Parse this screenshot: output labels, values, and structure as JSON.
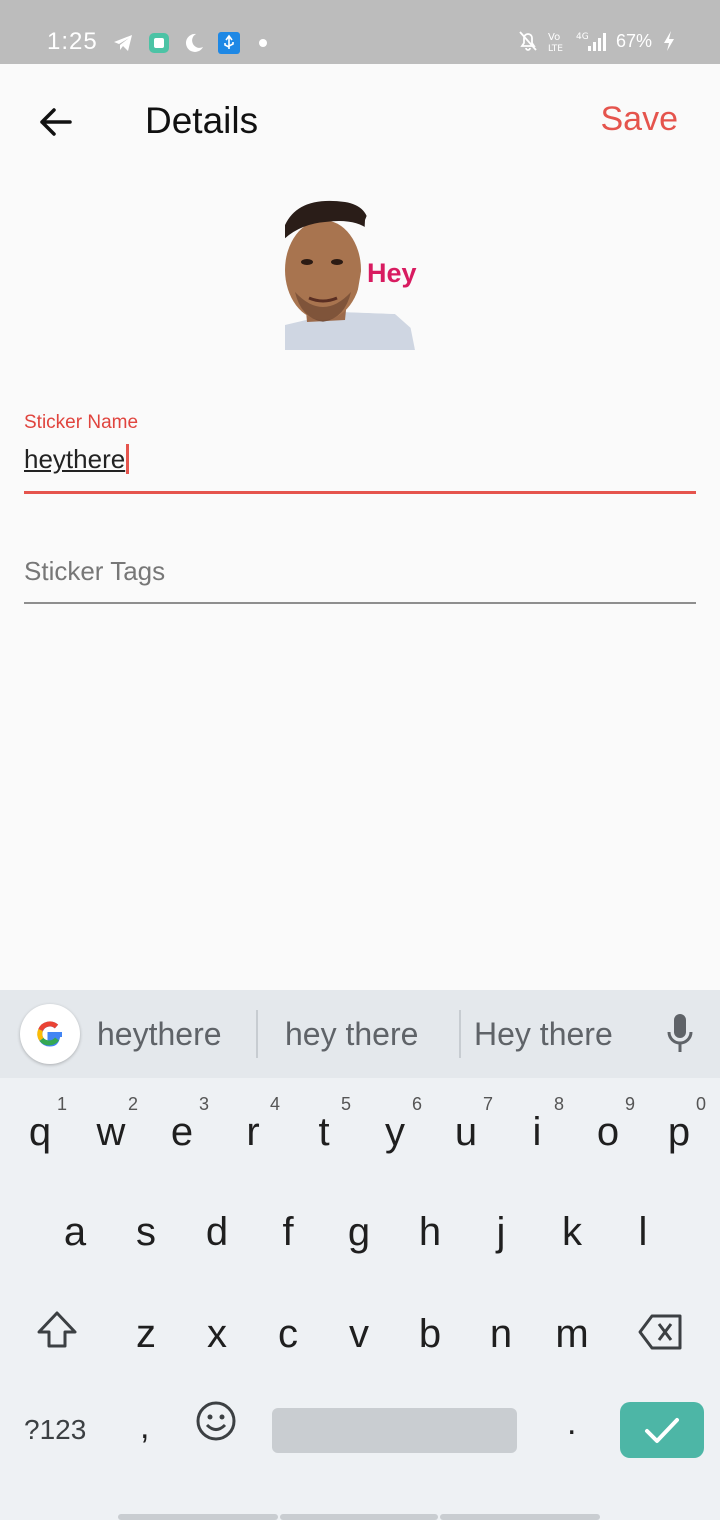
{
  "status_bar": {
    "time": "1:25",
    "battery": "67%",
    "icons": [
      "telegram-icon",
      "app-icon",
      "moon-icon",
      "usb-icon",
      "dot-icon",
      "mute-icon",
      "volte-icon",
      "signal-4g-icon",
      "charging-icon"
    ]
  },
  "app_bar": {
    "title": "Details",
    "save_label": "Save"
  },
  "sticker": {
    "caption": "Hey",
    "caption_color": "#d81b60"
  },
  "form": {
    "name_label": "Sticker Name",
    "name_value": "heythere",
    "tags_placeholder": "Sticker Tags"
  },
  "keyboard": {
    "suggestions": [
      "heythere",
      "hey there",
      "Hey there"
    ],
    "row1": [
      {
        "ch": "q",
        "n": "1"
      },
      {
        "ch": "w",
        "n": "2"
      },
      {
        "ch": "e",
        "n": "3"
      },
      {
        "ch": "r",
        "n": "4"
      },
      {
        "ch": "t",
        "n": "5"
      },
      {
        "ch": "y",
        "n": "6"
      },
      {
        "ch": "u",
        "n": "7"
      },
      {
        "ch": "i",
        "n": "8"
      },
      {
        "ch": "o",
        "n": "9"
      },
      {
        "ch": "p",
        "n": "0"
      }
    ],
    "row2": [
      "a",
      "s",
      "d",
      "f",
      "g",
      "h",
      "j",
      "k",
      "l"
    ],
    "row3": [
      "z",
      "x",
      "c",
      "v",
      "b",
      "n",
      "m"
    ],
    "symbols_label": "?123",
    "comma": ",",
    "period": "."
  },
  "colors": {
    "accent": "#e5544d",
    "enter_key": "#4db6a6",
    "status_bar": "#bcbcbc"
  }
}
